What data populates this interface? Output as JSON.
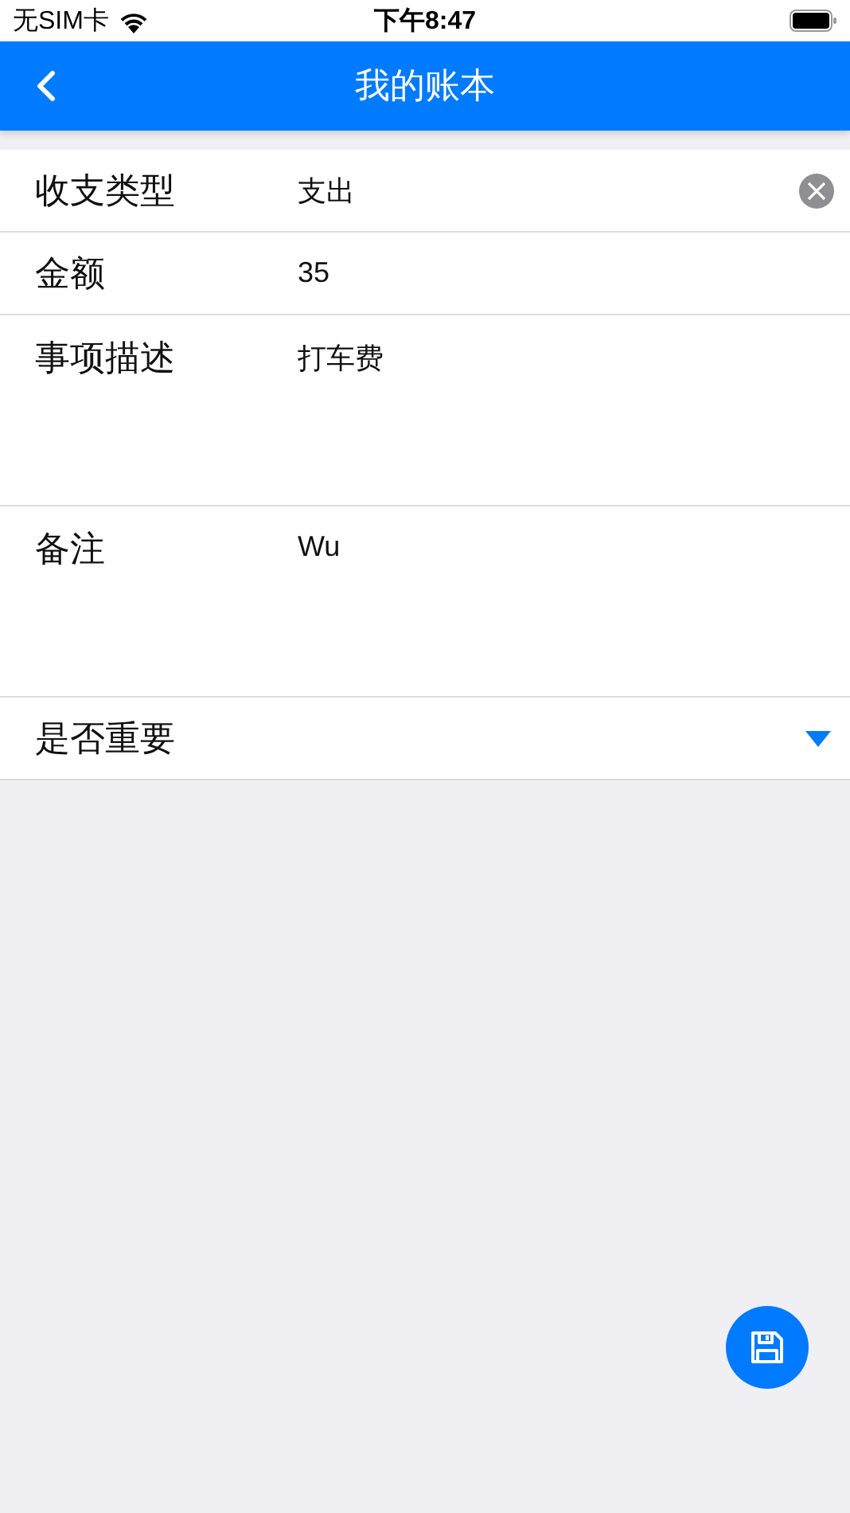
{
  "status_bar": {
    "carrier": "无SIM卡",
    "time": "下午8:47"
  },
  "nav_bar": {
    "title": "我的账本"
  },
  "fields": [
    {
      "kind": "select",
      "label": "收支类型",
      "value": "支出"
    },
    {
      "kind": "input",
      "label": "金额",
      "value": "35"
    },
    {
      "kind": "textarea",
      "label": "事项描述",
      "value": "打车费"
    },
    {
      "kind": "textarea",
      "label": "备注",
      "value": "Wu"
    },
    {
      "kind": "dropdown",
      "label": "是否重要"
    }
  ]
}
